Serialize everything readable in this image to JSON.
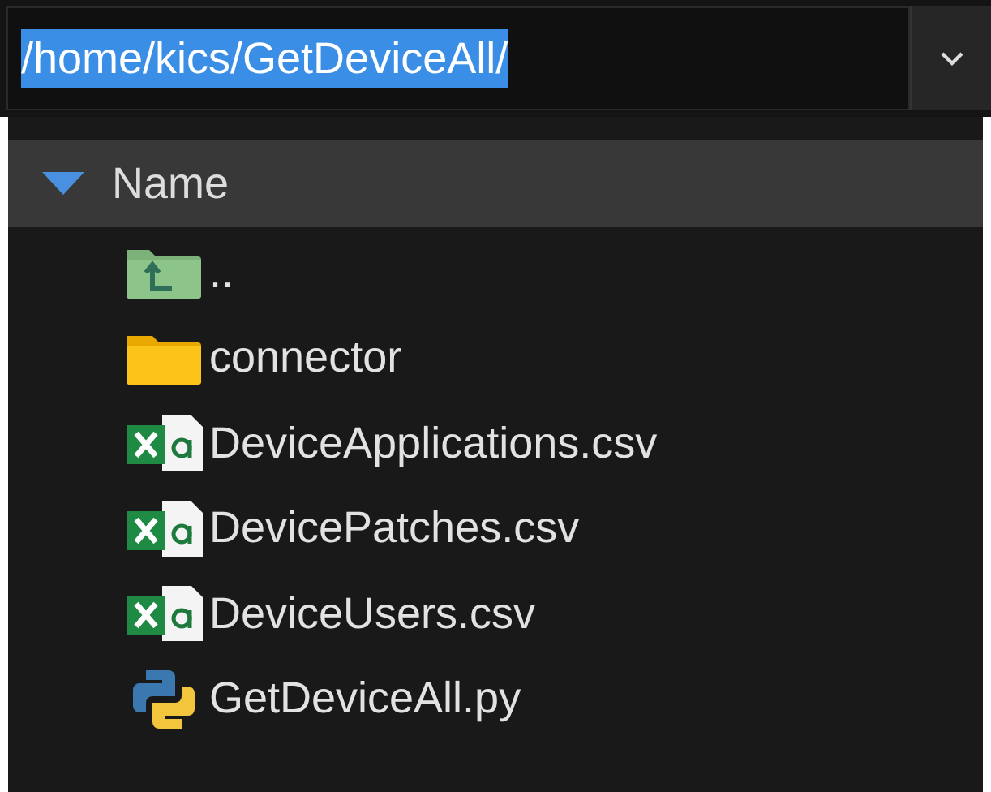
{
  "path_bar": {
    "value": "/home/kics/GetDeviceAll/",
    "selected": true
  },
  "column_header": {
    "label": "Name",
    "expanded": true
  },
  "files": [
    {
      "kind": "parent",
      "name": ".."
    },
    {
      "kind": "folder",
      "name": "connector"
    },
    {
      "kind": "spreadsheet",
      "name": "DeviceApplications.csv"
    },
    {
      "kind": "spreadsheet",
      "name": "DevicePatches.csv"
    },
    {
      "kind": "spreadsheet",
      "name": "DeviceUsers.csv"
    },
    {
      "kind": "python",
      "name": "GetDeviceAll.py"
    }
  ]
}
